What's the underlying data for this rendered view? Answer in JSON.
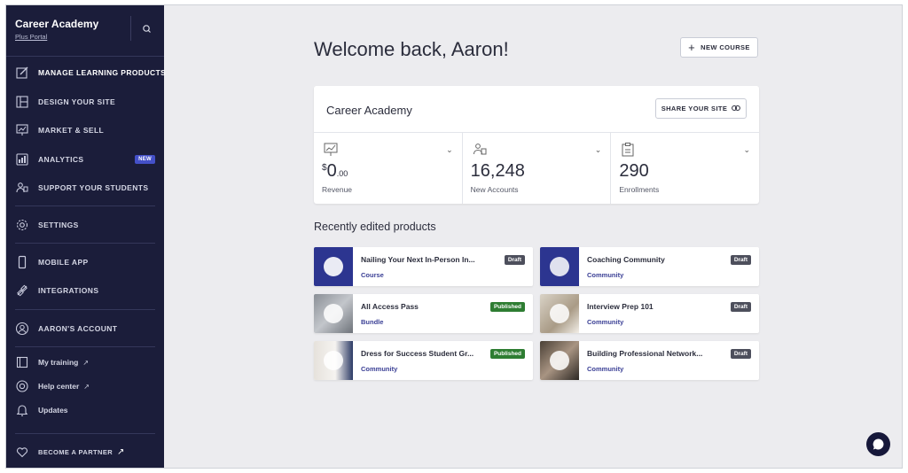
{
  "sidebar": {
    "brand_title": "Career Academy",
    "brand_sub": "Plus Portal",
    "items": [
      {
        "label": "MANAGE LEARNING PRODUCTS",
        "icon": "edit-icon"
      },
      {
        "label": "DESIGN YOUR SITE",
        "icon": "layout-icon"
      },
      {
        "label": "MARKET & SELL",
        "icon": "presentation-icon"
      },
      {
        "label": "ANALYTICS",
        "icon": "analytics-icon",
        "badge": "NEW"
      },
      {
        "label": "SUPPORT YOUR STUDENTS",
        "icon": "students-icon"
      },
      {
        "label": "SETTINGS",
        "icon": "gear-icon"
      },
      {
        "label": "MOBILE APP",
        "icon": "phone-icon"
      },
      {
        "label": "INTEGRATIONS",
        "icon": "plug-icon"
      },
      {
        "label": "AARON'S ACCOUNT",
        "icon": "user-icon"
      },
      {
        "label": "My training",
        "icon": "book-icon"
      },
      {
        "label": "Help center",
        "icon": "lifebuoy-icon"
      },
      {
        "label": "Updates",
        "icon": "bell-icon"
      },
      {
        "label": "BECOME A PARTNER",
        "icon": "heart-hands-icon"
      }
    ]
  },
  "main": {
    "welcome": "Welcome back, Aaron!",
    "new_course_label": "NEW COURSE",
    "site_name": "Career Academy",
    "share_label": "SHARE YOUR SITE",
    "stats": [
      {
        "currency": "$",
        "value": "0",
        "decimals": ".00",
        "label": "Revenue"
      },
      {
        "value": "16,248",
        "label": "New Accounts"
      },
      {
        "value": "290",
        "label": "Enrollments"
      }
    ],
    "recent_title": "Recently edited products",
    "products": [
      {
        "name": "Nailing Your Next In-Person In...",
        "type": "Course",
        "status": "Draft"
      },
      {
        "name": "Coaching Community",
        "type": "Community",
        "status": "Draft"
      },
      {
        "name": "All Access Pass",
        "type": "Bundle",
        "status": "Published"
      },
      {
        "name": "Interview Prep 101",
        "type": "Community",
        "status": "Draft"
      },
      {
        "name": "Dress for Success Student Gr...",
        "type": "Community",
        "status": "Published"
      },
      {
        "name": "Building Professional Network...",
        "type": "Community",
        "status": "Draft"
      }
    ]
  },
  "colors": {
    "sidebar_bg": "#1b1d3a",
    "accent": "#3a3f95",
    "draft": "#4d4f5c",
    "published": "#2e7d32",
    "new_badge": "#4450c8"
  }
}
